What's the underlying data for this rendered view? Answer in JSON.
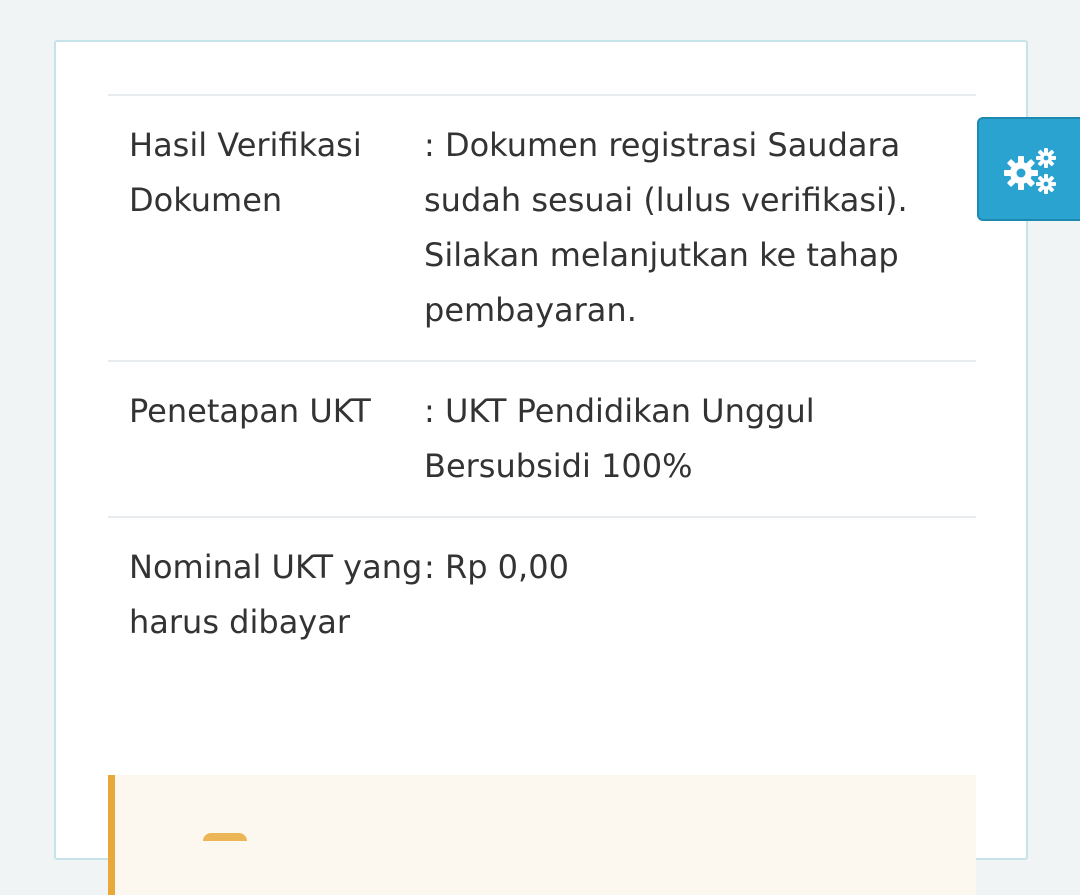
{
  "rows": [
    {
      "label": "Hasil Verifikasi Dokumen",
      "value": ": Dokumen registrasi Saudara sudah sesuai (lulus verifikasi). Silakan melanjutkan ke tahap pembayaran."
    },
    {
      "label": "Penetapan UKT",
      "value": ": UKT Pendidikan Unggul Bersubsidi 100%"
    },
    {
      "label": "Nominal UKT yang harus dibayar",
      "value": ": Rp 0,00"
    }
  ],
  "settings_button": {
    "icon": "gears-icon"
  },
  "colors": {
    "background": "#f1f4f5",
    "card_border": "#c7e3ea",
    "settings_button": "#2aa3d1",
    "alert_accent": "#e9a93a",
    "alert_background": "#fdf8ef",
    "text": "#333333"
  }
}
